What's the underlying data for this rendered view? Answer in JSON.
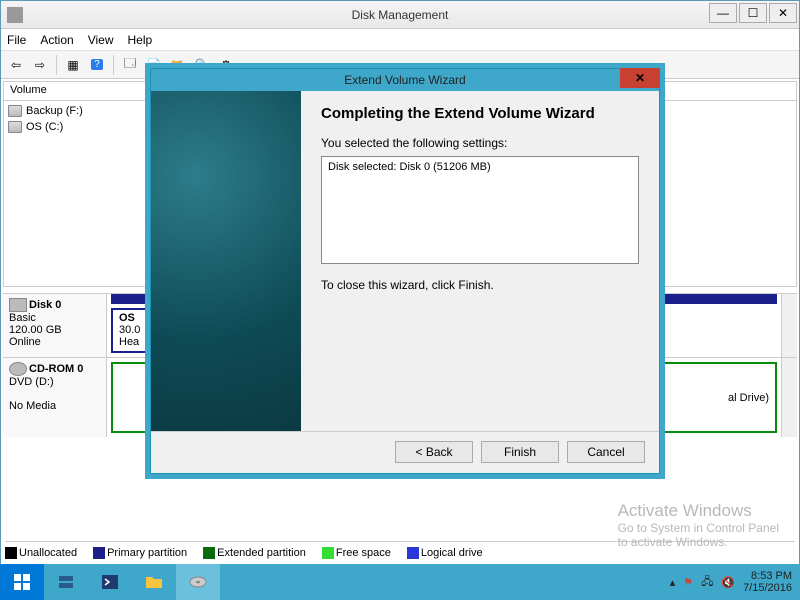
{
  "window": {
    "title": "Disk Management",
    "menus": [
      "File",
      "Action",
      "View",
      "Help"
    ],
    "win_controls": {
      "min": "—",
      "max": "☐",
      "close": "✕"
    }
  },
  "toolbar_icons": [
    "back",
    "forward",
    "list",
    "help",
    "refresh",
    "new",
    "open",
    "find",
    "custom"
  ],
  "volumes": {
    "header": "Volume",
    "items": [
      {
        "label": "Backup (F:)"
      },
      {
        "label": "OS (C:)"
      }
    ]
  },
  "disks": [
    {
      "id": "Disk 0",
      "type": "Basic",
      "size": "120.00 GB",
      "status": "Online",
      "parts": [
        {
          "label_line1": "OS",
          "label_line2": "30.0",
          "label_line3": "Hea",
          "style": "os"
        }
      ]
    },
    {
      "id": "CD-ROM 0",
      "type": "DVD (D:)",
      "size": "",
      "status": "No Media",
      "parts": [
        {
          "label_line1": "",
          "label_line2": "al Drive)",
          "label_line3": "",
          "style": "cd"
        }
      ]
    }
  ],
  "legend": [
    {
      "color": "#000000",
      "label": "Unallocated"
    },
    {
      "color": "#1a1f8a",
      "label": "Primary partition"
    },
    {
      "color": "#0a6b0a",
      "label": "Extended partition"
    },
    {
      "color": "#35dd35",
      "label": "Free space"
    },
    {
      "color": "#2b36d6",
      "label": "Logical drive"
    }
  ],
  "watermark": {
    "line1": "Activate Windows",
    "line2": "Go to System in Control Panel",
    "line3": "to activate Windows."
  },
  "taskbar": {
    "items": [
      "start",
      "server",
      "powershell",
      "explorer",
      "diskmgmt"
    ],
    "clock_time": "8:53 PM",
    "clock_date": "7/15/2016"
  },
  "wizard": {
    "title": "Extend Volume Wizard",
    "heading": "Completing the Extend Volume Wizard",
    "intro": "You selected the following settings:",
    "settings": "Disk selected: Disk 0 (51206 MB)",
    "closing": "To close this wizard, click Finish.",
    "buttons": {
      "back": "< Back",
      "finish": "Finish",
      "cancel": "Cancel"
    }
  }
}
